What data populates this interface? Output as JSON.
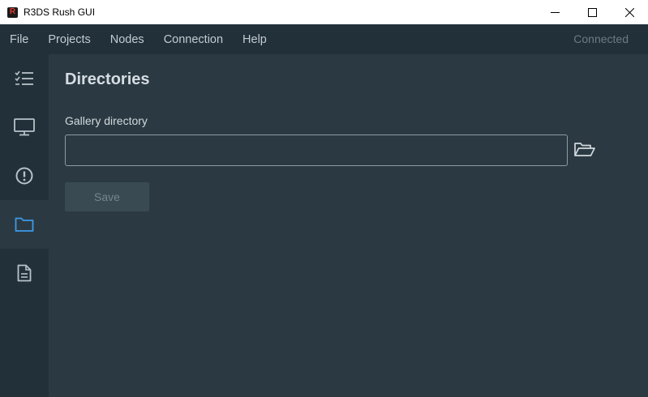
{
  "window": {
    "title": "R3DS Rush GUI",
    "logo_letter": "R"
  },
  "menu": {
    "items": [
      "File",
      "Projects",
      "Nodes",
      "Connection",
      "Help"
    ],
    "status": "Connected"
  },
  "sidebar": {
    "items": [
      {
        "icon": "checklist-icon",
        "active": false
      },
      {
        "icon": "monitor-icon",
        "active": false
      },
      {
        "icon": "alert-circle-icon",
        "active": false
      },
      {
        "icon": "folder-icon",
        "active": true
      },
      {
        "icon": "document-icon",
        "active": false
      }
    ]
  },
  "main": {
    "title": "Directories",
    "gallery_label": "Gallery directory",
    "gallery_value": "",
    "save_label": "Save"
  },
  "colors": {
    "accent": "#3d9be9",
    "background": "#2b3a42",
    "sidebar": "#22303a"
  }
}
